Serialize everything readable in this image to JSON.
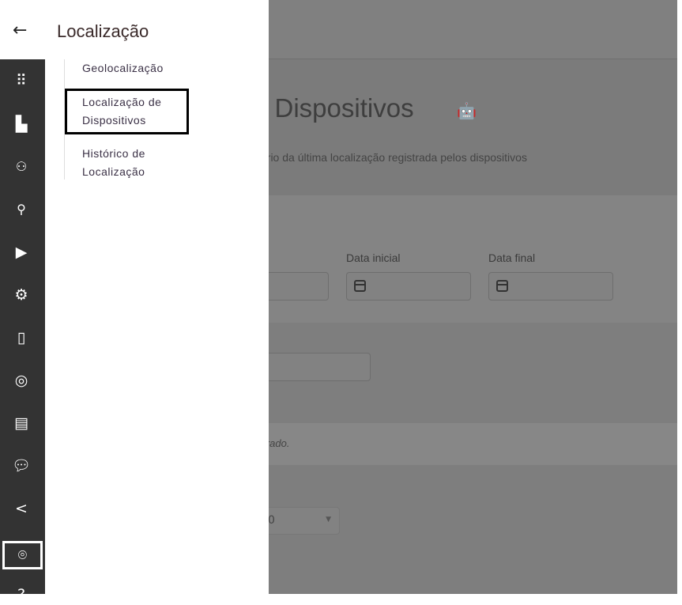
{
  "panel": {
    "back_icon": "arrow-left-icon",
    "title": "Localização",
    "items": [
      {
        "label": "Geolocalização"
      },
      {
        "label": "Localização de Dispositivos",
        "selected": true
      },
      {
        "label": "Histórico de Localização"
      }
    ]
  },
  "rail": {
    "icons": [
      "apps-grid-icon",
      "buildings-icon",
      "users-icon",
      "user-icon",
      "play-store-icon",
      "gear-icon",
      "phone-icon",
      "radar-icon",
      "browser-window-icon",
      "chat-icon",
      "share-icon",
      "location-pin-icon",
      "help-icon"
    ],
    "active": "location-pin-icon"
  },
  "page": {
    "title": "e Dispositivos",
    "subtitle": "ório da última localização registrada pelos dispositivos",
    "label_start": "Data inicial",
    "label_end": "Data final",
    "empty": "ntrado.",
    "select_value": "0"
  }
}
